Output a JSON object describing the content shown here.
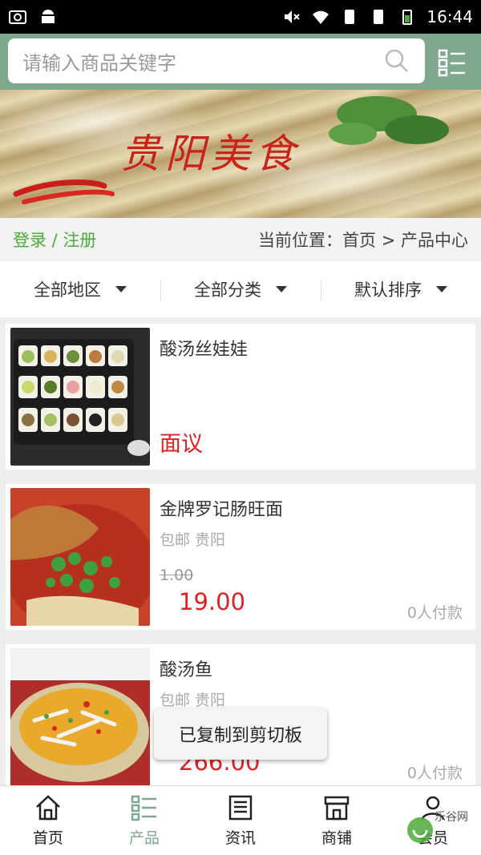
{
  "status_bar": {
    "time": "16:44"
  },
  "search": {
    "placeholder": "请输入商品关键字"
  },
  "banner": {
    "title": "贵阳美食"
  },
  "breadcrumb": {
    "login": "登录 / 注册",
    "location": "当前位置：首页 > 产品中心"
  },
  "filters": [
    {
      "label": "全部地区"
    },
    {
      "label": "全部分类"
    },
    {
      "label": "默认排序"
    }
  ],
  "products": [
    {
      "name": "酸汤丝娃娃",
      "price": "面议"
    },
    {
      "name": "金牌罗记肠旺面",
      "location": "包邮 贵阳",
      "old_price": "1.00",
      "price": "19.00",
      "sold": "0人付款"
    },
    {
      "name": "酸汤鱼",
      "location": "包邮 贵阳",
      "price": "266.00",
      "sold": "0人付款"
    }
  ],
  "toast": {
    "text": "已复制到剪切板"
  },
  "nav": [
    {
      "label": "首页",
      "icon": "home-icon"
    },
    {
      "label": "产品",
      "icon": "list-icon",
      "active": true
    },
    {
      "label": "资讯",
      "icon": "news-icon"
    },
    {
      "label": "商铺",
      "icon": "shop-icon"
    },
    {
      "label": "会员",
      "icon": "user-icon"
    }
  ],
  "watermark": {
    "text": "乐谷网"
  },
  "colors": {
    "theme_green": "#7fa98e",
    "price_red": "#e02020",
    "login_green": "#4caa3a"
  }
}
